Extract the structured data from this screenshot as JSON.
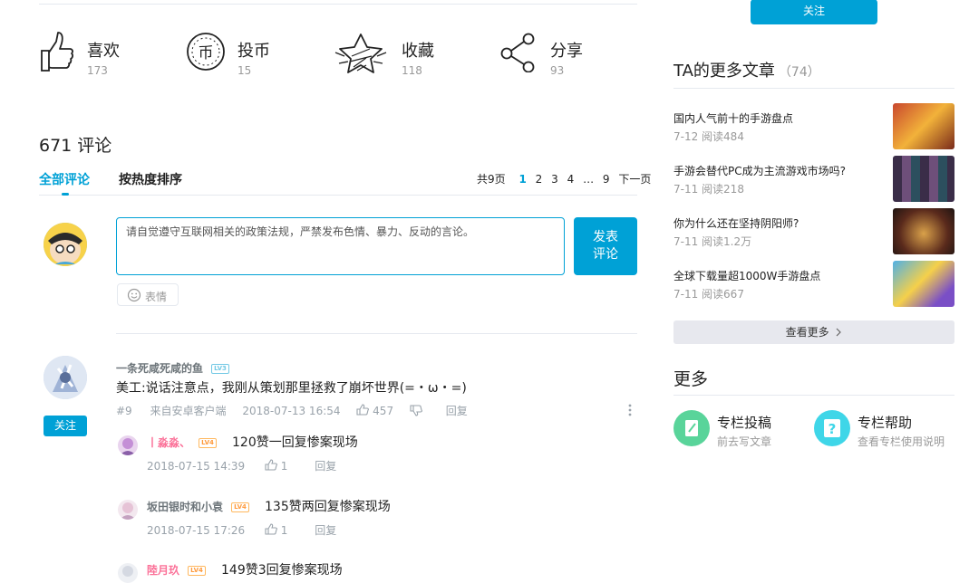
{
  "actions": {
    "like": {
      "label": "喜欢",
      "count": "173"
    },
    "coin": {
      "label": "投币",
      "count": "15"
    },
    "fav": {
      "label": "收藏",
      "count": "118"
    },
    "share": {
      "label": "分享",
      "count": "93"
    }
  },
  "comments": {
    "count_label": "671 评论",
    "tab_all": "全部评论",
    "tab_hot": "按热度排序",
    "pager": {
      "total": "共9页",
      "pages": [
        "1",
        "2",
        "3",
        "4",
        "…",
        "9"
      ],
      "next": "下一页"
    },
    "input_placeholder": "请自觉遵守互联网相关的政策法规，严禁发布色情、暴力、反动的言论。",
    "send_label": "发表\n评论",
    "emoji_label": "表情",
    "main": {
      "username": "一条死咸死咸的鱼",
      "level": "LV3",
      "text": "美工:说话注意点，我刚从策划那里拯救了崩坏世界(=・ω・=)",
      "floor": "#9",
      "source": "来自安卓客户端",
      "time": "2018-07-13 16:54",
      "likes": "457",
      "reply": "回复",
      "follow": "关注"
    },
    "replies": [
      {
        "username": "丨淼淼、",
        "level": "LV4",
        "text": "120赞一回复惨案现场",
        "time": "2018-07-15 14:39",
        "likes": "1",
        "reply": "回复"
      },
      {
        "username": "坂田银时和小袁",
        "level": "LV4",
        "text": "135赞两回复惨案现场",
        "time": "2018-07-15 17:26",
        "likes": "1",
        "reply": "回复"
      },
      {
        "username": "陸月玖",
        "level": "LV4",
        "text": "149赞3回复惨案现场"
      }
    ]
  },
  "sidebar": {
    "follow": "关注",
    "more_title": "TA的更多文章",
    "more_count": "（74）",
    "articles": [
      {
        "title": "国内人气前十的手游盘点",
        "meta": "7-12  阅读484"
      },
      {
        "title": "手游会替代PC成为主流游戏市场吗?",
        "meta": "7-11  阅读218"
      },
      {
        "title": "你为什么还在坚持阴阳师?",
        "meta": "7-11  阅读1.2万"
      },
      {
        "title": "全球下载量超1000W手游盘点",
        "meta": "7-11  阅读667"
      }
    ],
    "see_more": "查看更多",
    "section_more": "更多",
    "contribute": {
      "title": "专栏投稿",
      "sub": "前去写文章"
    },
    "help": {
      "title": "专栏帮助",
      "sub": "查看专栏使用说明"
    }
  },
  "colors": {
    "accent": "#00a1d6",
    "pink": "#fb7299",
    "green": "#59d49a",
    "cyan": "#3fd6e8"
  }
}
